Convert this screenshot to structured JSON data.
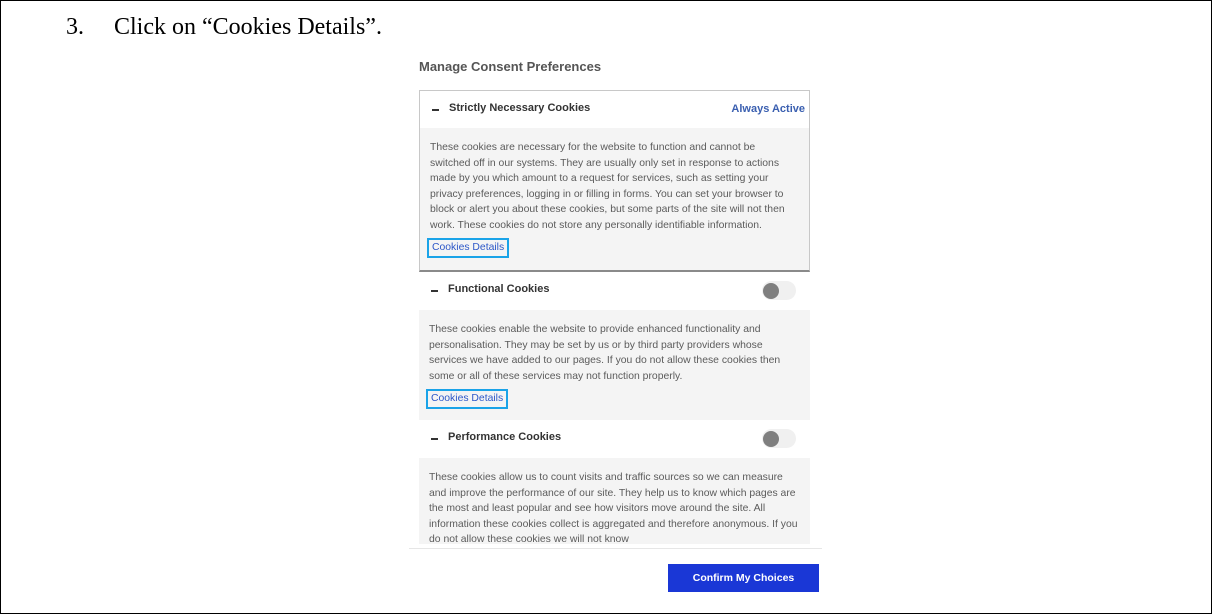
{
  "step": {
    "number": "3.",
    "text": "Click on “Cookies Details”."
  },
  "panel": {
    "title": "Manage Consent Preferences"
  },
  "sections": [
    {
      "title": "Strictly Necessary Cookies",
      "status": "Always Active",
      "description": "These cookies are necessary for the website to function and cannot be switched off in our systems. They are usually only set in response to actions made by you which amount to a request for services, such as setting your privacy preferences, logging in or filling in forms. You can set your browser to block or alert you about these cookies, but some parts of the site will not then work. These cookies do not store any personally identifiable information.",
      "link": "Cookies Details"
    },
    {
      "title": "Functional Cookies",
      "toggle_on": false,
      "description": "These cookies enable the website to provide enhanced functionality and personalisation. They may be set by us or by third party providers whose services we have added to our pages. If you do not allow these cookies then some or all of these services may not function properly.",
      "link": "Cookies Details"
    },
    {
      "title": "Performance Cookies",
      "toggle_on": false,
      "description": "These cookies allow us to count visits and traffic sources so we can measure and improve the performance of our site. They help us to know which pages are the most and least popular and see how visitors move around the site. All information these cookies collect is aggregated and therefore anonymous. If you do not allow these cookies we will not know"
    }
  ],
  "footer": {
    "confirm_label": "Confirm My Choices"
  },
  "colors": {
    "accent": "#1a37d6",
    "link": "#2c57c8",
    "highlight_box": "#1aa3e8",
    "always_active": "#3a5fb0"
  }
}
